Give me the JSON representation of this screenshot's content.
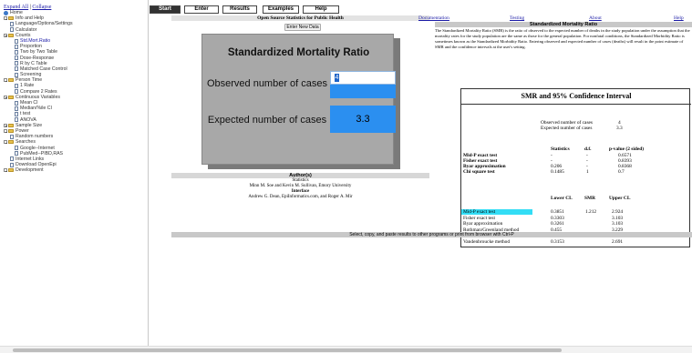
{
  "sidebar": {
    "expand_all": "Expand All",
    "separator": "|",
    "collapse": "Collapse",
    "items": [
      {
        "label": "Home",
        "level": 0,
        "icon": "globe-icon"
      },
      {
        "label": "Info and Help",
        "level": 0,
        "icon": "folder-icon",
        "expander": true
      },
      {
        "label": "Language/Options/Settings",
        "level": 1,
        "icon": "page-icon"
      },
      {
        "label": "Calculator",
        "level": 1,
        "icon": "page-icon"
      },
      {
        "label": "Counts",
        "level": 0,
        "icon": "folder-icon",
        "expander": true
      },
      {
        "label": "Std.Mort.Ratio",
        "level": 2,
        "icon": "page-icon",
        "selected": true
      },
      {
        "label": "Proportion",
        "level": 2,
        "icon": "page-icon"
      },
      {
        "label": "Two by Two Table",
        "level": 2,
        "icon": "page-icon"
      },
      {
        "label": "Dose-Response",
        "level": 2,
        "icon": "page-icon"
      },
      {
        "label": "R by C Table",
        "level": 2,
        "icon": "page-icon"
      },
      {
        "label": "Matched Case Control",
        "level": 2,
        "icon": "page-icon"
      },
      {
        "label": "Screening",
        "level": 2,
        "icon": "page-icon"
      },
      {
        "label": "Person Time",
        "level": 0,
        "icon": "folder-icon",
        "expander": true
      },
      {
        "label": "1 Rate",
        "level": 2,
        "icon": "page-icon"
      },
      {
        "label": "Compare 2 Rates",
        "level": 2,
        "icon": "page-icon"
      },
      {
        "label": "Continuous Variables",
        "level": 0,
        "icon": "folder-icon",
        "expander": true
      },
      {
        "label": "Mean CI",
        "level": 2,
        "icon": "page-icon"
      },
      {
        "label": "Median/%ile CI",
        "level": 2,
        "icon": "page-icon"
      },
      {
        "label": "t test",
        "level": 2,
        "icon": "page-icon"
      },
      {
        "label": "ANOVA",
        "level": 2,
        "icon": "page-icon"
      },
      {
        "label": "Sample Size",
        "level": 0,
        "icon": "folder-icon",
        "expander": true
      },
      {
        "label": "Power",
        "level": 0,
        "icon": "folder-icon",
        "expander": true
      },
      {
        "label": "Random numbers",
        "level": 1,
        "icon": "page-icon"
      },
      {
        "label": "Searches",
        "level": 0,
        "icon": "folder-icon",
        "expander": true
      },
      {
        "label": "Google--Internet",
        "level": 2,
        "icon": "page-icon"
      },
      {
        "label": "PubMed--PIBD,RAS",
        "level": 2,
        "icon": "page-icon"
      },
      {
        "label": "Internet Links",
        "level": 1,
        "icon": "page-icon"
      },
      {
        "label": "Download OpenEpi",
        "level": 1,
        "icon": "page-icon"
      },
      {
        "label": "Development",
        "level": 0,
        "icon": "folder-icon",
        "expander": true
      }
    ]
  },
  "tabs": [
    "Start",
    "Enter",
    "Results",
    "Examples",
    "Help"
  ],
  "main": {
    "header": "Open Source Statistics for Public Health",
    "new_data_button": "Enter New Data",
    "calc_title": "Standardized Mortality Ratio",
    "observed_label": "Observed number of cases",
    "observed_value": "4",
    "expected_label": "Expected number of cases",
    "expected_value": "3.3",
    "authors_header": "Author(s)",
    "authors_line1": "Statistics",
    "authors_line2": "Minn M. Soe and Kevin M. Sullivan, Emory University",
    "authors_line3": "Interface",
    "authors_line4": "Andrew G. Dean, EpiInformatics.com, and Roger A. Mir",
    "bottom_note": "Select, copy, and paste results to other programs or print from browser with Ctrl-P"
  },
  "nav": [
    "Documentation",
    "Testing",
    "About",
    "Help"
  ],
  "results": {
    "title": "Standardized Mortality Ratio",
    "description": "The Standardized Mortality Ratio (SMR) is the ratio of observed to the expected number of deaths in the study population under the assumption that the mortality rates for the study population are the same as those for the general population. For nonfatal conditions, the Standardized Morbidity Ratio is sometimes known as the Standardized Morbidity Ratio. Entering observed and expected number of cases (deaths) will result in the point estimate of SMR and the confidence intervals at the user's setting.",
    "box_title": "SMR and 95% Confidence Interval",
    "observed_label": "Observed number of cases",
    "observed_value": "4",
    "expected_label": "Expected number of cases",
    "expected_value": "3.3",
    "test_headers": [
      "Statistics",
      "d.f.",
      "p-value (2 sided)"
    ],
    "tests": [
      {
        "name": "Mid-P exact test",
        "stat": "-",
        "df": "-",
        "p": "0.6571"
      },
      {
        "name": "Fisher exact test",
        "stat": "-",
        "df": "-",
        "p": "0.8393"
      },
      {
        "name": "Byar approximation",
        "stat": "0.206",
        "df": "-",
        "p": "0.8368"
      },
      {
        "name": "Chi square test",
        "stat": "0.1485",
        "df": "1",
        "p": "0.7"
      }
    ],
    "ci_headers": [
      "Lower CL",
      "SMR",
      "Upper CL"
    ],
    "smr_value": "1.212",
    "ci_rows": [
      {
        "name": "Mid-P exact test",
        "lower": "0.3851",
        "upper": "2.924"
      },
      {
        "name": "Fisher exact test",
        "lower": "0.3303",
        "upper": "3.103"
      },
      {
        "name": "Byar approximation",
        "lower": "0.3261",
        "upper": "3.103"
      },
      {
        "name": "Rothman/Greenland method",
        "lower": "0.455",
        "upper": "3.229"
      },
      {
        "name": "Ury and Wiggins method",
        "lower": "0.3274",
        "upper": "3.096"
      },
      {
        "name": "Vandenbroucke method",
        "lower": "0.3153",
        "upper": "2.691"
      }
    ]
  },
  "colors": {
    "highlight": "#33ddf5",
    "input_blue": "#2b8ff0",
    "calc_gray": "#a8a8a8",
    "link": "#1a1aa6"
  }
}
